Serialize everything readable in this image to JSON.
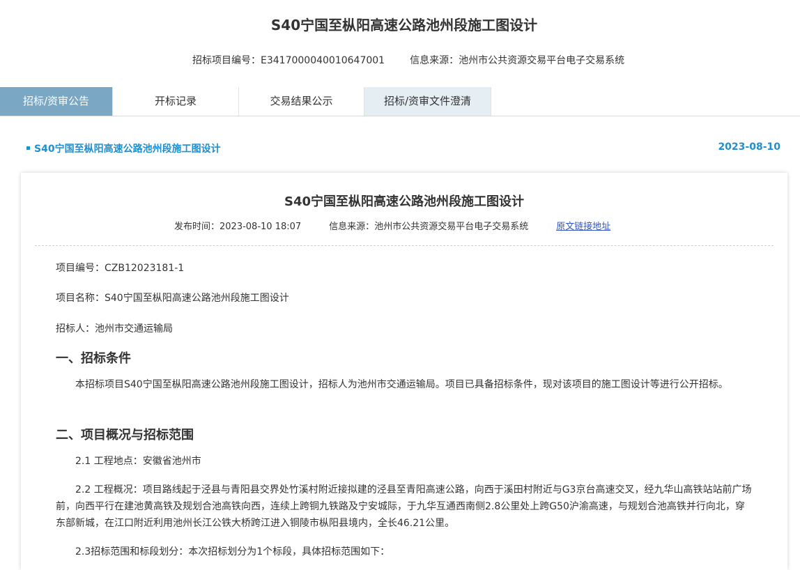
{
  "page": {
    "title": "S40宁国至枞阳高速公路池州段施工图设计",
    "project_code_label": "招标项目编号：",
    "project_code": "E3417000040010647001",
    "source_label": "信息来源：",
    "source": "池州市公共资源交易平台电子交易系统"
  },
  "tabs": [
    {
      "label": "招标/资审公告"
    },
    {
      "label": "开标记录"
    },
    {
      "label": "交易结果公示"
    },
    {
      "label": "招标/资审文件澄清"
    }
  ],
  "notice": {
    "title": "S40宁国至枞阳高速公路池州段施工图设计",
    "date": "2023-08-10"
  },
  "article": {
    "title": "S40宁国至枞阳高速公路池州段施工图设计",
    "publish_label": "发布时间：",
    "publish_time": "2023-08-10 18:07",
    "source_label": "信息来源：",
    "source": "池州市公共资源交易平台电子交易系统",
    "original_link": "原文链接地址",
    "project_no": "项目编号：CZB12023181-1",
    "project_name": "项目名称：S40宁国至枞阳高速公路池州段施工图设计",
    "tenderer": "招标人：池州市交通运输局",
    "section1_title": "一、招标条件",
    "section1_text": "本招标项目S40宁国至枞阳高速公路池州段施工图设计，招标人为池州市交通运输局。项目已具备招标条件，现对该项目的施工图设计等进行公开招标。",
    "section2_title": "二、项目概况与招标范围",
    "item_2_1": "2.1 工程地点：安徽省池州市",
    "item_2_2": "2.2 工程概况：项目路线起于泾县与青阳县交界处竹溪村附近接拟建的泾县至青阳高速公路，向西于溪田村附近与G3京台高速交叉，经九华山高铁站站前广场前，向西平行在建池黄高铁及规划合池高铁向西，连续上跨铜九铁路及宁安城际，于九华互通西南侧2.8公里处上跨G50沪渝高速，与规划合池高铁并行向北，穿东部新城，在江口附近利用池州长江公铁大桥跨江进入铜陵市枞阳县境内，全长46.21公里。",
    "item_2_3": "2.3招标范围和标段划分：本次招标划分为1个标段，具体招标范围如下："
  }
}
